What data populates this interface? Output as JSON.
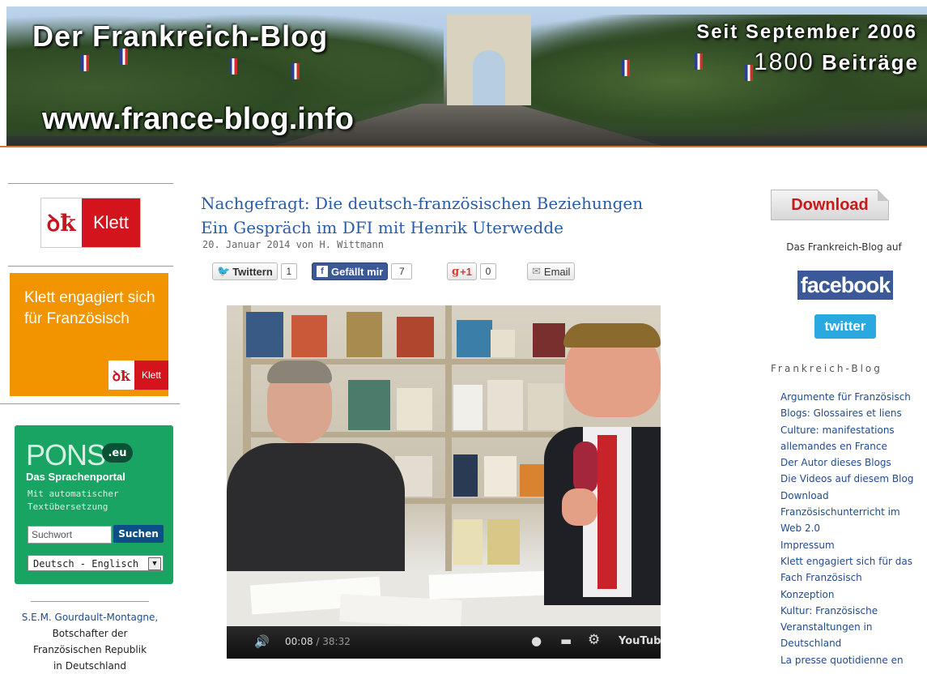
{
  "banner": {
    "title": "Der Frankreich-Blog",
    "url": "www.france-blog.info",
    "since": "Seit September 2006",
    "count": "1800",
    "count_label": "Beiträge"
  },
  "left": {
    "klett_logo_word": "Klett",
    "klett_ad_text": "Klett engagiert sich für Französisch",
    "klett_ad_logo_word": "Klett",
    "pons": {
      "logo": "PONS",
      "badge": ".eu",
      "title": "Das Sprachenportal",
      "subtitle": "Mit automatischer Textübersetzung",
      "search_placeholder": "Suchwort",
      "search_button": "Suchen",
      "language_select": "Deutsch - Englisch"
    },
    "bottom_lines": [
      "S.E.M. Gourdault-Montagne,",
      "Botschafter der",
      "Französischen Republik",
      "in Deutschland"
    ]
  },
  "post": {
    "title_line1": "Nachgefragt: Die deutsch-französischen Beziehungen",
    "title_line2": "Ein Gespräch im DFI mit Henrik Uterwedde",
    "meta": "20. Januar 2014 von H. Wittmann",
    "share": {
      "twitter_label": "Twittern",
      "twitter_count": "1",
      "facebook_label": "Gefällt mir",
      "facebook_count": "7",
      "gplus_label": "+1",
      "gplus_count": "0",
      "email_label": "Email"
    },
    "video": {
      "time_current": "00:08",
      "time_total": "/ 38:32",
      "brand": "YouTube"
    }
  },
  "right": {
    "download_label": "Download",
    "blog_on": "Das Frankreich-Blog auf",
    "facebook_label": "facebook",
    "twitter_label": "twitter",
    "heading": "Frankreich-Blog",
    "links": [
      "Argumente für Französisch",
      "Blogs: Glossaires et liens",
      "Culture: manifestations allemandes en France",
      "Der Autor dieses Blogs",
      "Die Videos auf diesem Blog",
      "Download",
      "Französischunterricht im Web 2.0",
      "Impressum",
      "Klett engagiert sich für das Fach Französisch",
      "Konzeption",
      "Kultur: Französische Veranstaltungen in Deutschland",
      "La presse quotidienne en"
    ]
  },
  "colors": {
    "link": "#2a5ca8",
    "klett_orange": "#f29400",
    "pons_green": "#1aa463",
    "facebook": "#3b5998",
    "twitter": "#2aa9e0"
  }
}
